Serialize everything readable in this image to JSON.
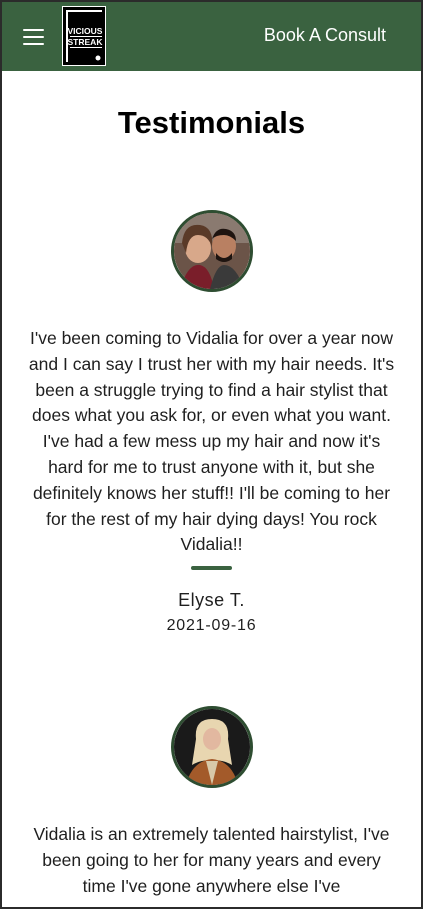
{
  "header": {
    "menu_icon": "hamburger-menu-icon",
    "logo_text": [
      "VICIOUS",
      "STREAK"
    ],
    "cta_label": "Book A Consult",
    "background_color": "#3a6240"
  },
  "page": {
    "title": "Testimonials"
  },
  "testimonials": [
    {
      "quote": "I've been coming to Vidalia for over a year now and I can say I trust her with my hair needs. It's been a struggle trying to find a hair stylist that does what you ask for, or even what you want. I've had a few mess up my hair and now it's hard for me to trust anyone with it, but she definitely knows her stuff!! I'll be coming to her for the rest of my hair dying days! You rock Vidalia!!",
      "author": "Elyse T.",
      "date": "2021-09-16"
    },
    {
      "quote": "Vidalia is an extremely talented hairstylist, I've been going to her for many years and every time I've gone anywhere else I've",
      "author": "",
      "date": ""
    }
  ]
}
